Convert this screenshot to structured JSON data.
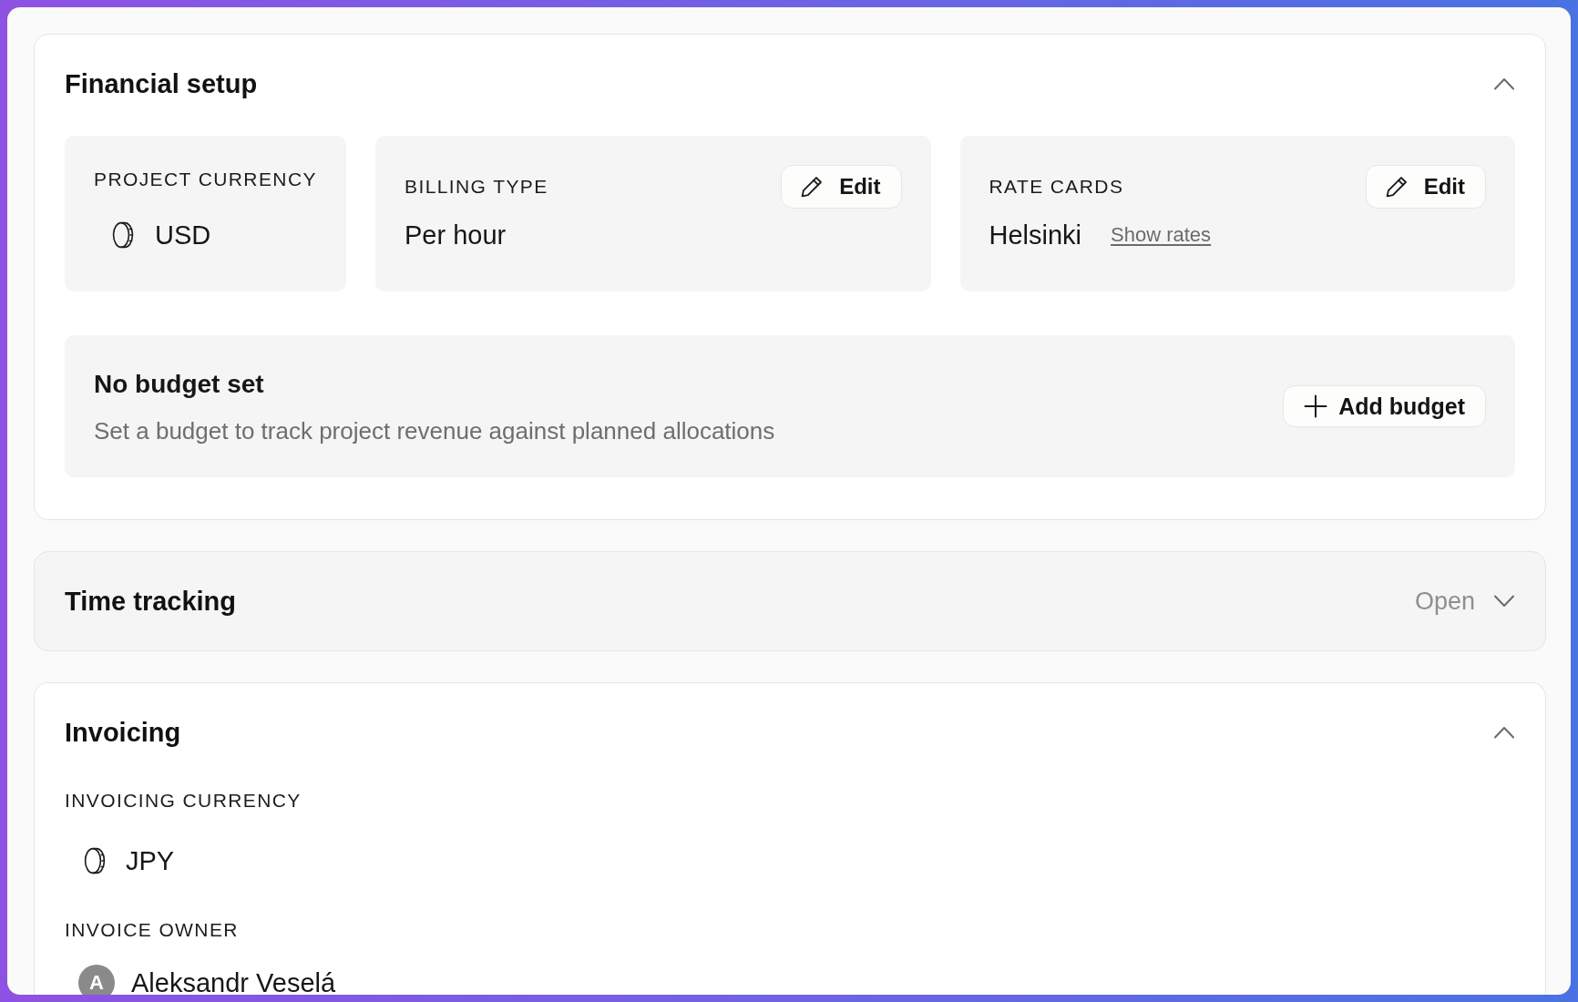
{
  "sections": [
    {
      "title": "Financial setup",
      "expanded": true,
      "tiled": true,
      "fields": [
        {
          "kind": "currency",
          "label": "PROJECT CURRENCY",
          "value": "USD"
        },
        {
          "kind": "text",
          "label": "BILLING TYPE",
          "value": "Per hour",
          "edit_button": "Edit"
        },
        {
          "kind": "text",
          "label": "RATE CARDS",
          "value": "Helsinki",
          "link": "Show rates",
          "edit_button": "Edit"
        }
      ],
      "budget": {
        "title": "No budget set",
        "description": "Set a budget to track project revenue against planned allocations",
        "button": "Add budget"
      }
    },
    {
      "title": "Time tracking",
      "expanded": false,
      "toggle_label": "Open"
    },
    {
      "title": "Invoicing",
      "expanded": true,
      "tiled": false,
      "fields": [
        {
          "kind": "currency",
          "label": "INVOICING CURRENCY",
          "value": "JPY"
        },
        {
          "kind": "person",
          "label": "INVOICE OWNER",
          "avatar_initial": "A",
          "value": "Aleksandr Veselá"
        }
      ]
    }
  ]
}
